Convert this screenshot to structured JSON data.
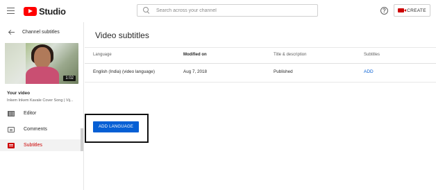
{
  "header": {
    "logo_text": "Studio",
    "search_placeholder": "Search across your channel",
    "help_glyph": "?",
    "create_label": "CREATE"
  },
  "sidebar": {
    "title": "Channel subtitles",
    "thumbnail": {
      "duration": "1:02"
    },
    "your_video_label": "Your video",
    "video_name": "Inkem Inkem Kavale Cover Song | Vij...",
    "items": [
      {
        "label": "Editor",
        "icon": "editor-icon",
        "active": false
      },
      {
        "label": "Comments",
        "icon": "comments-icon",
        "active": false
      },
      {
        "label": "Subtitles",
        "icon": "subtitles-icon",
        "active": true
      }
    ]
  },
  "main": {
    "title": "Video subtitles",
    "table": {
      "columns": [
        "Language",
        "Modified on",
        "Title & description",
        "Subtitles"
      ],
      "rows": [
        {
          "language": "English (India) (video language)",
          "modified_on": "Aug 7, 2018",
          "title_description": "Published",
          "subtitles": "ADD"
        }
      ]
    },
    "add_language_label": "ADD LANGUAGE"
  },
  "colors": {
    "brand_red": "#ff0000",
    "accent_blue": "#065fd4",
    "active_red": "#cc0000"
  }
}
